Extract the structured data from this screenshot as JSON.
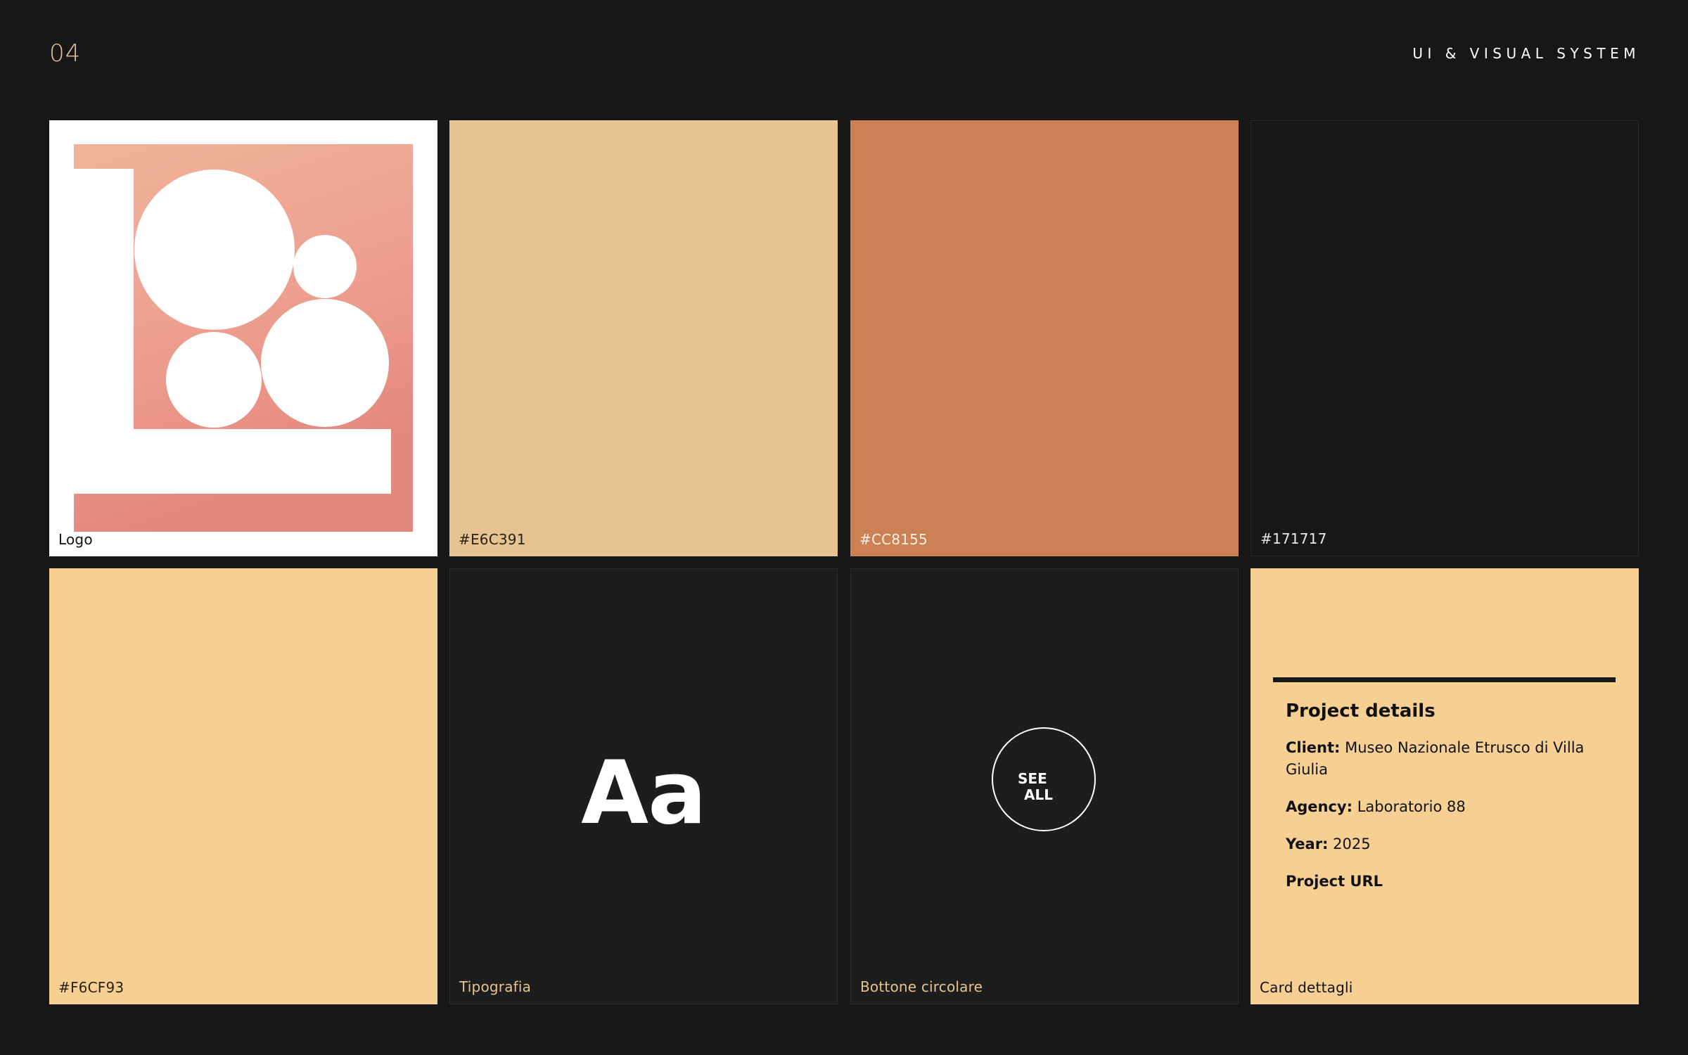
{
  "header": {
    "page_number": "04",
    "section_title": "UI & VISUAL SYSTEM"
  },
  "colors": {
    "background": "#171717",
    "accent": "#E6C391",
    "title_text": "#ffffff"
  },
  "tiles": [
    {
      "label": "Logo",
      "type": "logo",
      "background": "#ffffff",
      "label_color": "#111111"
    },
    {
      "label": "#E6C391",
      "type": "swatch",
      "background": "#E6C391",
      "label_color": "#2a2015"
    },
    {
      "label": "#CC8155",
      "type": "swatch",
      "background": "#CC8155",
      "label_color": "#fff2e6"
    },
    {
      "label": "#171717",
      "type": "swatch",
      "background": "#171717",
      "label_color": "#e8e8e8"
    },
    {
      "label": "#F6CF93",
      "type": "swatch",
      "background": "#F6CF93",
      "label_color": "#2a2015"
    },
    {
      "label": "Tipografia",
      "type": "typography",
      "sample": "Aa",
      "label_color": "#E6C391"
    },
    {
      "label": "Bottone circolare",
      "type": "button",
      "button_lines": [
        "SEE",
        "ALL"
      ],
      "label_color": "#E6C391"
    },
    {
      "label": "Card dettagli",
      "type": "details",
      "background": "#F6CF93",
      "label_color": "#111111"
    }
  ],
  "project_details": {
    "title": "Project details",
    "client_label": "Client:",
    "client_value": "Museo Nazionale Etrusco di Villa Giulia",
    "agency_label": "Agency:",
    "agency_value": "Laboratorio 88",
    "year_label": "Year:",
    "year_value": "2025",
    "url_label": "Project URL"
  }
}
